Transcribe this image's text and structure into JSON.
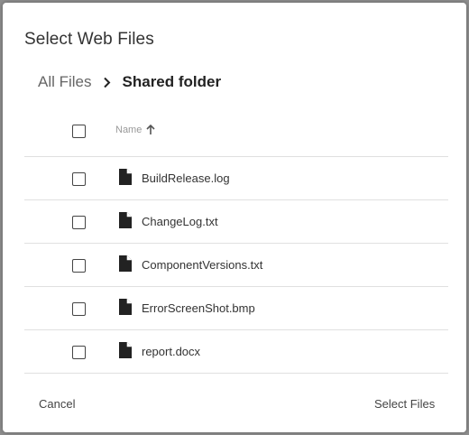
{
  "dialog": {
    "title": "Select Web Files",
    "breadcrumb": {
      "root": "All Files",
      "separator_icon": "chevron-right-icon",
      "current": "Shared folder"
    },
    "table": {
      "column_name": "Name",
      "sort_icon": "arrow-up-icon",
      "files": [
        {
          "name": "BuildRelease.log",
          "icon": "file-icon",
          "checked": false
        },
        {
          "name": "ChangeLog.txt",
          "icon": "file-icon",
          "checked": false
        },
        {
          "name": "ComponentVersions.txt",
          "icon": "file-icon",
          "checked": false
        },
        {
          "name": "ErrorScreenShot.bmp",
          "icon": "file-icon",
          "checked": false
        },
        {
          "name": "report.docx",
          "icon": "file-icon",
          "checked": false
        }
      ]
    },
    "footer": {
      "cancel_label": "Cancel",
      "select_label": "Select Files"
    }
  }
}
